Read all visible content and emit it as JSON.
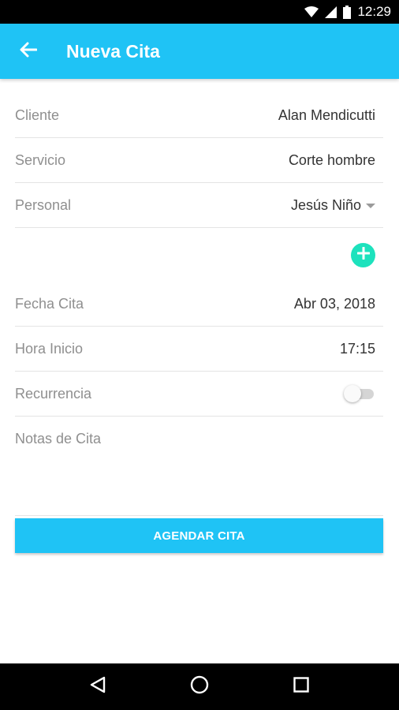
{
  "status_bar": {
    "time": "12:29"
  },
  "app_bar": {
    "title": "Nueva Cita",
    "accent_color": "#1fc3f5"
  },
  "form": {
    "cliente": {
      "label": "Cliente",
      "value": "Alan Mendicutti"
    },
    "servicio": {
      "label": "Servicio",
      "value": "Corte hombre"
    },
    "personal": {
      "label": "Personal",
      "value": "Jesús Niño"
    },
    "fecha_cita": {
      "label": "Fecha Cita",
      "value": "Abr 03, 2018"
    },
    "hora_inicio": {
      "label": "Hora Inicio",
      "value": "17:15"
    },
    "recurrencia": {
      "label": "Recurrencia",
      "enabled": false
    },
    "notas": {
      "label": "Notas de Cita",
      "value": ""
    }
  },
  "actions": {
    "submit_label": "AGENDAR CITA",
    "add_icon": "plus-circle-icon",
    "add_color": "#1de2bd"
  },
  "nav": {
    "icons": [
      "back-triangle-icon",
      "home-circle-icon",
      "recents-square-icon"
    ]
  }
}
